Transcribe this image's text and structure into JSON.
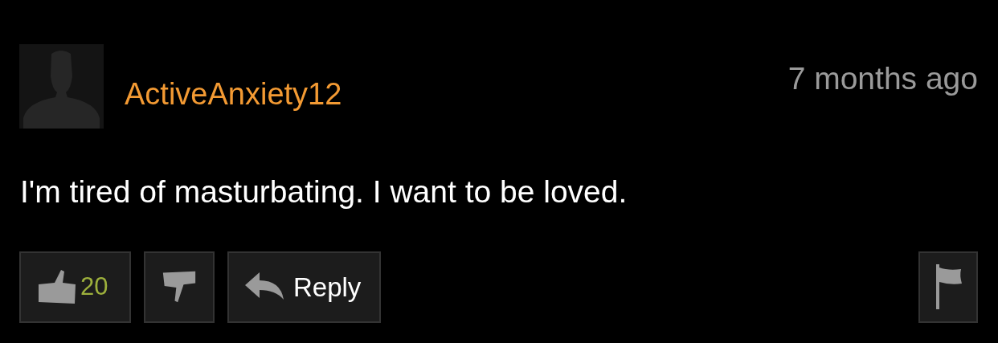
{
  "comment": {
    "username": "ActiveAnxiety12",
    "time": "7 months ago",
    "text": "I'm tired of masturbating. I want to be loved."
  },
  "actions": {
    "likes": "20",
    "reply_label": "Reply"
  }
}
